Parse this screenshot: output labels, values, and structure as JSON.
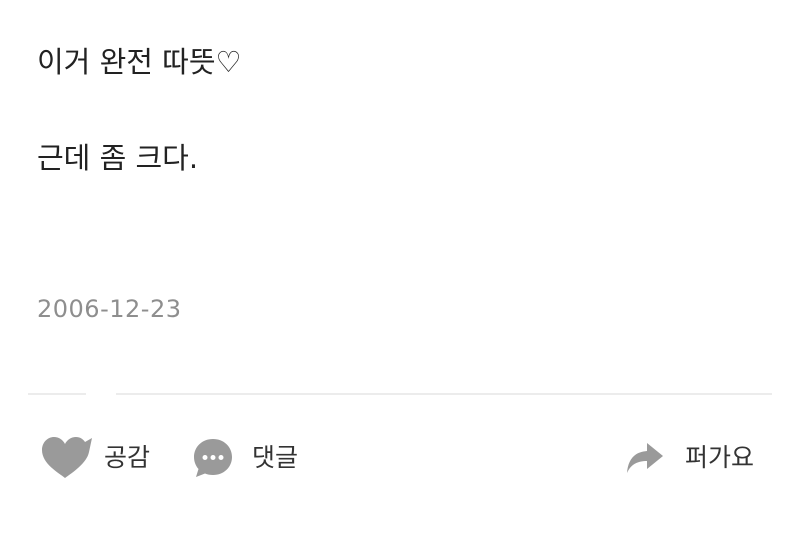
{
  "post": {
    "line1": "이거 완전 따뜻♡",
    "line2": "근데 좀 크다.",
    "date": "2006-12-23"
  },
  "actions": {
    "like_label": "공감",
    "comment_label": "댓글",
    "share_label": "퍼가요"
  },
  "icons": {
    "like": "heart-icon",
    "comment": "speech-bubble-icon",
    "share": "share-arrow-icon"
  },
  "colors": {
    "icon": "#9a9a9a",
    "text": "#222222",
    "date": "#8e8e8e",
    "divider": "#ececec"
  }
}
